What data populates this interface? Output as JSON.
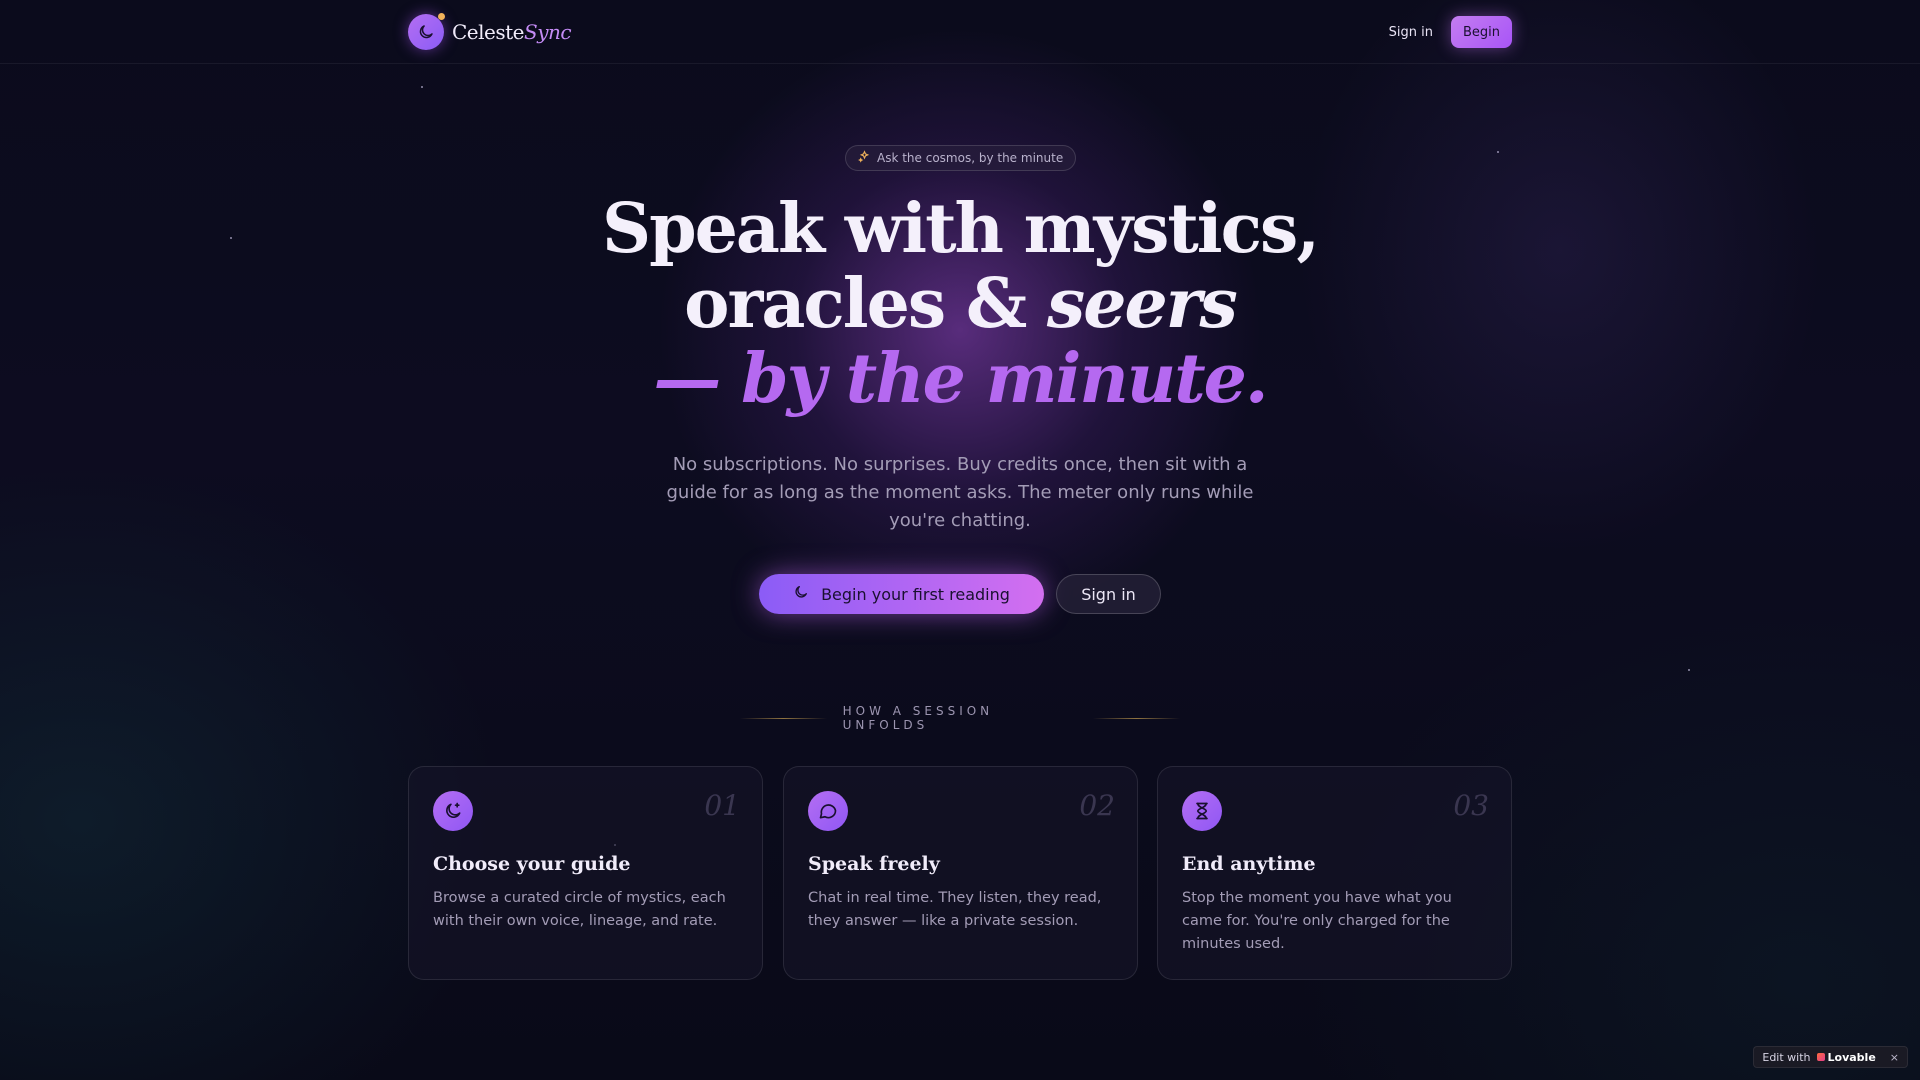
{
  "brand": {
    "name_plain": "Celeste",
    "name_em": "Sync",
    "icon": "moon-icon"
  },
  "nav": {
    "signin": "Sign in",
    "begin": "Begin"
  },
  "hero": {
    "badge": {
      "icon": "sparkles-icon",
      "text": "Ask the cosmos, by the minute"
    },
    "headline": {
      "line1": "Speak with mystics,",
      "line2_plain": "oracles & ",
      "line2_em": "seers",
      "line3": "— by the minute."
    },
    "subtext": "No subscriptions. No surprises. Buy credits once, then sit with a guide for as long as the moment asks. The meter only runs while you're chatting.",
    "cta_primary": {
      "icon": "moon-icon",
      "label": "Begin your first reading"
    },
    "cta_secondary": {
      "label": "Sign in"
    }
  },
  "section": {
    "heading": "HOW A SESSION UNFOLDS",
    "cards": [
      {
        "icon": "moon-star-icon",
        "number": "01",
        "title": "Choose your guide",
        "desc": "Browse a curated circle of mystics, each with their own voice, lineage, and rate."
      },
      {
        "icon": "chat-bubble-icon",
        "number": "02",
        "title": "Speak freely",
        "desc": "Chat in real time. They listen, they read, they answer — like a private session."
      },
      {
        "icon": "hourglass-icon",
        "number": "03",
        "title": "End anytime",
        "desc": "Stop the moment you have what you came for. You're only charged for the minutes used."
      }
    ]
  },
  "badge": {
    "prefix": "Edit with",
    "brand": "Lovable",
    "close": "×"
  },
  "colors": {
    "accent": "#a855f7",
    "accent_light": "#c48bf5",
    "background": "#0a0a1a",
    "gold": "#f0b25a"
  }
}
